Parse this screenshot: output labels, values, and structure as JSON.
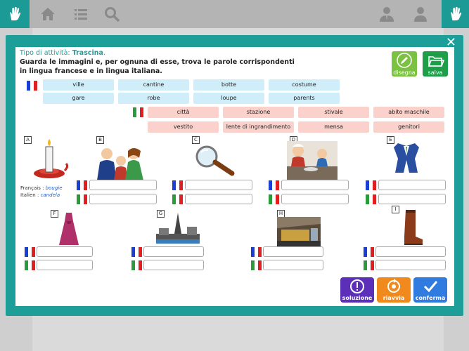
{
  "activity": {
    "type_label": "Tipo di attività:",
    "type_value": "Trascina",
    "type_period": ".",
    "instruction_line1": "Guarda le immagini e, per ognuna di esse, trova le parole corrispondenti",
    "instruction_line2": "in lingua francese e in lingua italiana."
  },
  "tools": {
    "draw_label": "disegna",
    "save_label": "salva"
  },
  "french_words": [
    "ville",
    "cantine",
    "botte",
    "costume",
    "gare",
    "robe",
    "loupe",
    "parents"
  ],
  "italian_words": [
    "città",
    "stazione",
    "stivale",
    "abito maschile",
    "vestito",
    "lente di ingrandimento",
    "mensa",
    "genitori"
  ],
  "items": [
    {
      "letter": "A",
      "picture": "candle-icon"
    },
    {
      "letter": "B",
      "picture": "family-icon"
    },
    {
      "letter": "C",
      "picture": "magnifying-glass-icon"
    },
    {
      "letter": "D",
      "picture": "canteen-icon"
    },
    {
      "letter": "E",
      "picture": "suit-icon"
    },
    {
      "letter": "F",
      "picture": "dress-icon"
    },
    {
      "letter": "G",
      "picture": "city-icon"
    },
    {
      "letter": "H",
      "picture": "station-icon"
    },
    {
      "letter": "I",
      "picture": "boot-icon"
    }
  ],
  "example": {
    "fr_label": "Français :",
    "fr_word": "bougie",
    "it_label": "Italien :",
    "it_word": "candela"
  },
  "actions": {
    "solution": "soluzione",
    "restart": "riavvia",
    "confirm": "conferma"
  },
  "colors": {
    "teal": "#1e9e99",
    "fr_chip": "#cfeefa",
    "it_chip": "#fbd2cb",
    "solution": "#5b2fb8",
    "restart": "#f08a1c",
    "confirm": "#2f7be0"
  }
}
